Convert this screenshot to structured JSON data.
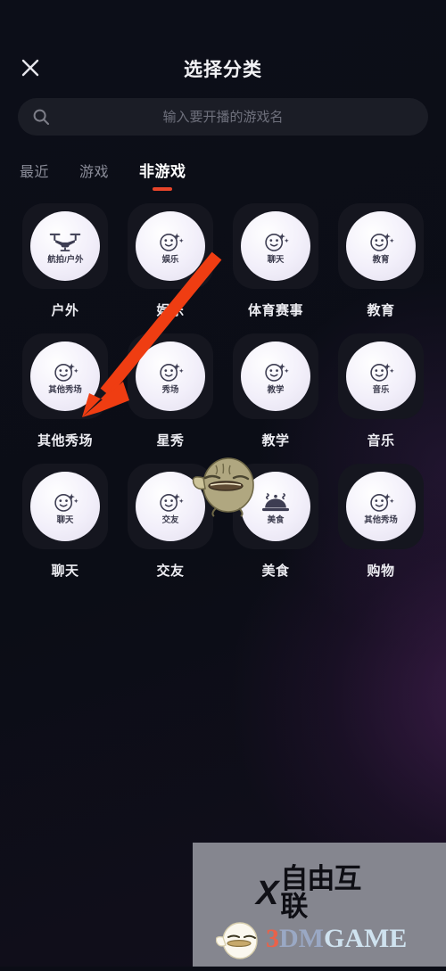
{
  "header": {
    "close_icon": "close-icon",
    "title": "选择分类"
  },
  "search": {
    "icon": "search-icon",
    "value": "",
    "placeholder": "输入要开播的游戏名"
  },
  "tabs": [
    {
      "label": "最近",
      "active": false
    },
    {
      "label": "游戏",
      "active": false
    },
    {
      "label": "非游戏",
      "active": true
    }
  ],
  "tabs_accent_color": "#e8452a",
  "categories": [
    {
      "label": "户外",
      "glyph_label": "航拍/户外",
      "icon": "drone-icon"
    },
    {
      "label": "娱乐",
      "glyph_label": "娱乐",
      "icon": "smiley-sparkle-icon"
    },
    {
      "label": "体育赛事",
      "glyph_label": "聊天",
      "icon": "smiley-sparkle-icon"
    },
    {
      "label": "教育",
      "glyph_label": "教育",
      "icon": "smiley-sparkle-icon"
    },
    {
      "label": "其他秀场",
      "glyph_label": "其他秀场",
      "icon": "smiley-sparkle-icon"
    },
    {
      "label": "星秀",
      "glyph_label": "秀场",
      "icon": "smiley-sparkle-icon"
    },
    {
      "label": "教学",
      "glyph_label": "教学",
      "icon": "smiley-sparkle-icon"
    },
    {
      "label": "音乐",
      "glyph_label": "音乐",
      "icon": "smiley-sparkle-icon"
    },
    {
      "label": "聊天",
      "glyph_label": "聊天",
      "icon": "smiley-sparkle-icon"
    },
    {
      "label": "交友",
      "glyph_label": "交友",
      "icon": "smiley-sparkle-icon"
    },
    {
      "label": "美食",
      "glyph_label": "美食",
      "icon": "food-cloche-icon"
    },
    {
      "label": "购物",
      "glyph_label": "其他秀场",
      "icon": "smiley-sparkle-icon"
    }
  ],
  "annotation": {
    "arrow_color": "#ef3d12",
    "target": "其他秀场"
  },
  "watermark": {
    "x_mark": "X",
    "brand_cn": "自由互联",
    "site_part1": "3",
    "site_part2": "DM",
    "site_part3": "GAME",
    "background_color": "#85868f"
  }
}
